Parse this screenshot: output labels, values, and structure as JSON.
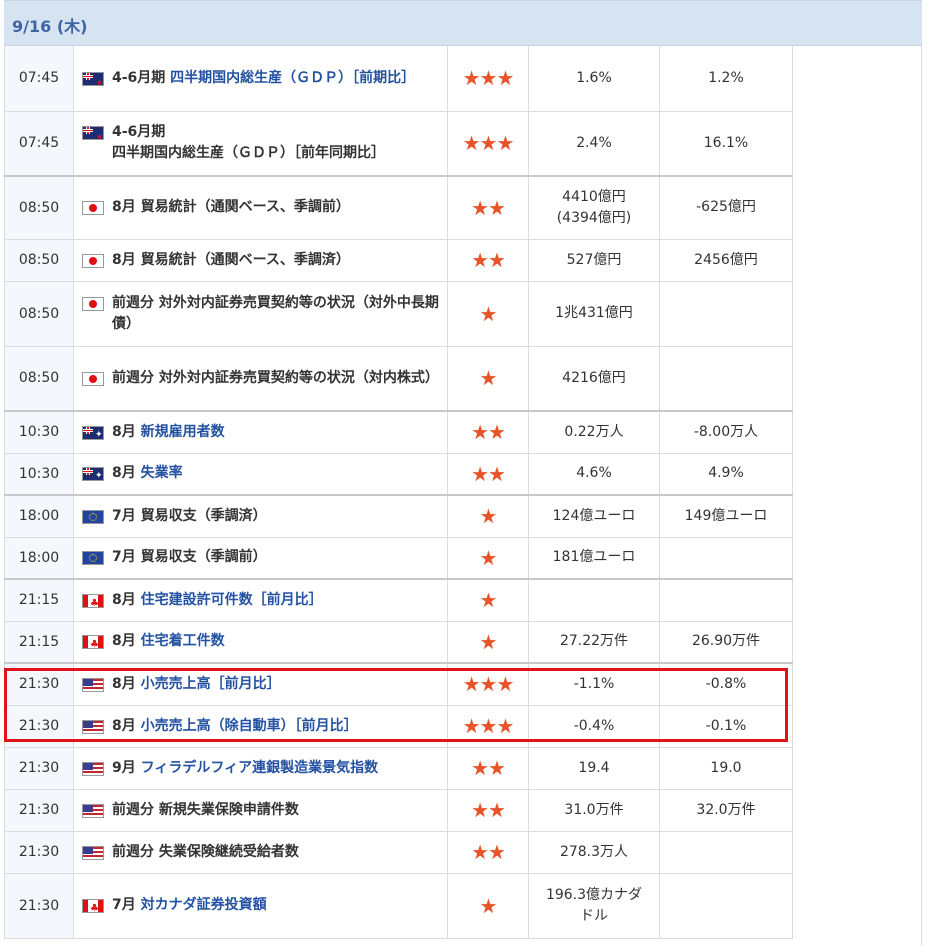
{
  "header": {
    "date": "9/16 (木)"
  },
  "star_glyph": "★",
  "colors": {
    "accent": "#3e64a6",
    "link": "#2451a2",
    "star": "#e8542a",
    "highlight": "#e0131b"
  },
  "rows": [
    {
      "time": "07:45",
      "flag": "nz",
      "period": "4-6月期",
      "name": "四半期国内総生産（ＧＤＰ）［前期比］",
      "linked": true,
      "stars": 3,
      "forecast": "1.6%",
      "previous": "1.2%"
    },
    {
      "time": "07:45",
      "flag": "nz",
      "period": "4-6月期",
      "name": "四半期国内総生産（ＧＤＰ）［前年同期比］",
      "linked": false,
      "stars": 3,
      "forecast": "2.4%",
      "previous": "16.1%"
    },
    {
      "time": "08:50",
      "flag": "jp",
      "period": "8月",
      "name": "貿易統計（通関ベース、季調前）",
      "linked": false,
      "stars": 2,
      "forecast": "4410億円\n(4394億円)",
      "previous": "-625億円",
      "group_start": true
    },
    {
      "time": "08:50",
      "flag": "jp",
      "period": "8月",
      "name": "貿易統計（通関ベース、季調済）",
      "linked": false,
      "stars": 2,
      "forecast": "527億円",
      "previous": "2456億円"
    },
    {
      "time": "08:50",
      "flag": "jp",
      "period": "前週分",
      "name": "対外対内証券売買契約等の状況（対外中長期債）",
      "linked": false,
      "stars": 1,
      "forecast": "1兆431億円",
      "previous": ""
    },
    {
      "time": "08:50",
      "flag": "jp",
      "period": "前週分",
      "name": "対外対内証券売買契約等の状況（対内株式）",
      "linked": false,
      "stars": 1,
      "forecast": "4216億円",
      "previous": ""
    },
    {
      "time": "10:30",
      "flag": "au",
      "period": "8月",
      "name": "新規雇用者数",
      "linked": true,
      "stars": 2,
      "forecast": "0.22万人",
      "previous": "-8.00万人",
      "group_start": true
    },
    {
      "time": "10:30",
      "flag": "au",
      "period": "8月",
      "name": "失業率",
      "linked": true,
      "stars": 2,
      "forecast": "4.6%",
      "previous": "4.9%"
    },
    {
      "time": "18:00",
      "flag": "eu",
      "period": "7月",
      "name": "貿易収支（季調済）",
      "linked": false,
      "stars": 1,
      "forecast": "124億ユーロ",
      "previous": "149億ユーロ",
      "group_start": true
    },
    {
      "time": "18:00",
      "flag": "eu",
      "period": "7月",
      "name": "貿易収支（季調前）",
      "linked": false,
      "stars": 1,
      "forecast": "181億ユーロ",
      "previous": ""
    },
    {
      "time": "21:15",
      "flag": "ca",
      "period": "8月",
      "name": "住宅建設許可件数［前月比］",
      "linked": true,
      "stars": 1,
      "forecast": "",
      "previous": "",
      "group_start": true
    },
    {
      "time": "21:15",
      "flag": "ca",
      "period": "8月",
      "name": "住宅着工件数",
      "linked": true,
      "stars": 1,
      "forecast": "27.22万件",
      "previous": "26.90万件"
    },
    {
      "time": "21:30",
      "flag": "us",
      "period": "8月",
      "name": "小売売上高［前月比］",
      "linked": true,
      "stars": 3,
      "forecast": "-1.1%",
      "previous": "-0.8%",
      "group_start": true
    },
    {
      "time": "21:30",
      "flag": "us",
      "period": "8月",
      "name": "小売売上高（除自動車）［前月比］",
      "linked": true,
      "stars": 3,
      "forecast": "-0.4%",
      "previous": "-0.1%"
    },
    {
      "time": "21:30",
      "flag": "us",
      "period": "9月",
      "name": "フィラデルフィア連銀製造業景気指数",
      "linked": true,
      "stars": 2,
      "forecast": "19.4",
      "previous": "19.0"
    },
    {
      "time": "21:30",
      "flag": "us",
      "period": "前週分",
      "name": "新規失業保険申請件数",
      "linked": false,
      "stars": 2,
      "forecast": "31.0万件",
      "previous": "32.0万件"
    },
    {
      "time": "21:30",
      "flag": "us",
      "period": "前週分",
      "name": "失業保険継続受給者数",
      "linked": false,
      "stars": 2,
      "forecast": "278.3万人",
      "previous": ""
    },
    {
      "time": "21:30",
      "flag": "ca",
      "period": "7月",
      "name": "対カナダ証券投資額",
      "linked": true,
      "stars": 1,
      "forecast": "196.3億カナダドル",
      "previous": ""
    }
  ]
}
